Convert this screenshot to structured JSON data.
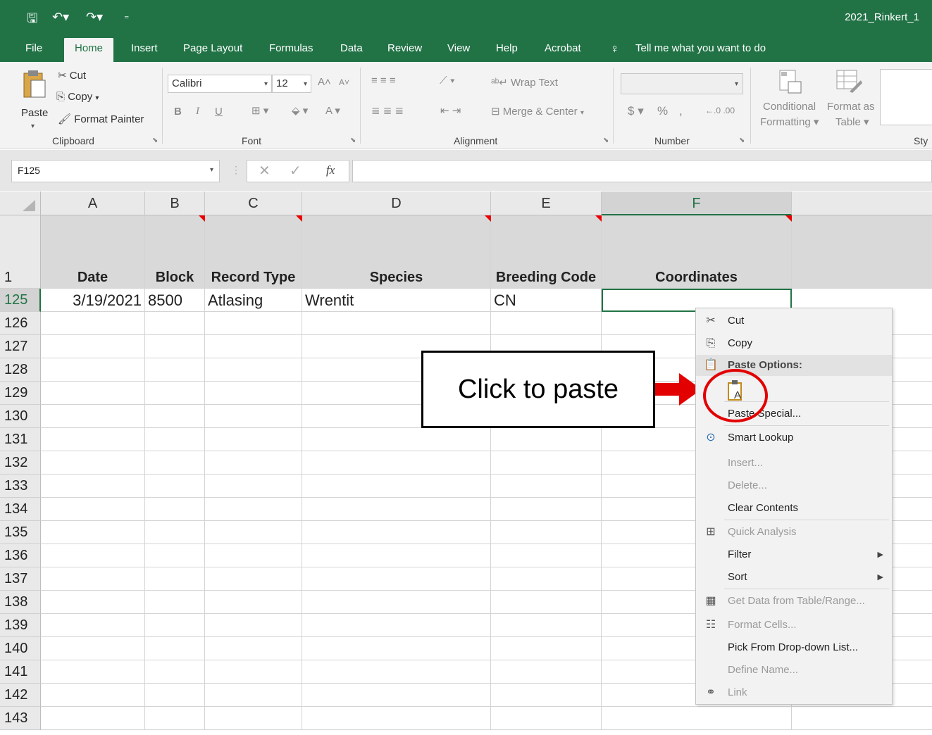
{
  "title_bar": {
    "document_title": "2021_Rinkert_1"
  },
  "ribbon_tabs": [
    "File",
    "Home",
    "Insert",
    "Page Layout",
    "Formulas",
    "Data",
    "Review",
    "View",
    "Help",
    "Acrobat"
  ],
  "active_tab": "Home",
  "tell_me": "Tell me what you want to do",
  "clipboard": {
    "paste": "Paste",
    "cut": "Cut",
    "copy": "Copy",
    "format_painter": "Format Painter",
    "group_label": "Clipboard"
  },
  "font": {
    "name": "Calibri",
    "size": "12",
    "group_label": "Font",
    "bold": "B",
    "italic": "I",
    "underline": "U"
  },
  "alignment": {
    "wrap_text": "Wrap Text",
    "merge_center": "Merge & Center",
    "group_label": "Alignment"
  },
  "number": {
    "currency": "$",
    "percent": "%",
    "comma": ",",
    "group_label": "Number"
  },
  "styles": {
    "conditional_formatting": [
      "Conditional",
      "Formatting"
    ],
    "format_as_table": [
      "Format as",
      "Table"
    ],
    "group_label": "Sty"
  },
  "formula_bar": {
    "name_box": "F125",
    "fx": "fx",
    "formula": ""
  },
  "columns": [
    "A",
    "B",
    "C",
    "D",
    "E",
    "F"
  ],
  "selected_column": "F",
  "header_row": {
    "row_number": "1",
    "cells": [
      "Date",
      "Block",
      "Record Type",
      "Species",
      "Breeding Code",
      "Coordinates"
    ]
  },
  "data_rows": [
    {
      "row_number": "125",
      "cells": [
        "3/19/2021",
        "8500",
        "Atlasing",
        "Wrentit",
        "CN",
        ""
      ]
    }
  ],
  "empty_rows": [
    "126",
    "127",
    "128",
    "129",
    "130",
    "131",
    "132",
    "133",
    "134",
    "135",
    "136",
    "137",
    "138",
    "139",
    "140",
    "141",
    "142",
    "143"
  ],
  "callout": {
    "text": "Click to paste",
    "accent_color": "#e30000"
  },
  "context_menu": {
    "items": [
      {
        "label": "Cut",
        "icon": "scissors-icon",
        "enabled": true
      },
      {
        "label": "Copy",
        "icon": "copy-icon",
        "enabled": true
      },
      {
        "label": "Paste Options:",
        "icon": "paste-icon",
        "enabled": true,
        "header": true
      },
      {
        "label": "",
        "icon": "paste-values-icon",
        "enabled": true
      },
      {
        "label": "Paste Special...",
        "icon": "",
        "enabled": true
      },
      {
        "label": "Smart Lookup",
        "icon": "smart-lookup-icon",
        "enabled": true
      },
      {
        "label": "Insert...",
        "icon": "",
        "enabled": false
      },
      {
        "label": "Delete...",
        "icon": "",
        "enabled": false
      },
      {
        "label": "Clear Contents",
        "icon": "",
        "enabled": true
      },
      {
        "label": "Quick Analysis",
        "icon": "quick-analysis-icon",
        "enabled": false
      },
      {
        "label": "Filter",
        "icon": "",
        "enabled": true,
        "submenu": true
      },
      {
        "label": "Sort",
        "icon": "",
        "enabled": true,
        "submenu": true
      },
      {
        "label": "Get Data from Table/Range...",
        "icon": "table-icon",
        "enabled": false
      },
      {
        "label": "Format Cells...",
        "icon": "format-cells-icon",
        "enabled": false
      },
      {
        "label": "Pick From Drop-down List...",
        "icon": "",
        "enabled": true
      },
      {
        "label": "Define Name...",
        "icon": "",
        "enabled": false
      },
      {
        "label": "Link",
        "icon": "link-icon",
        "enabled": false
      }
    ]
  },
  "colors": {
    "excel_green": "#217346",
    "comment_indicator": "#e00000"
  }
}
